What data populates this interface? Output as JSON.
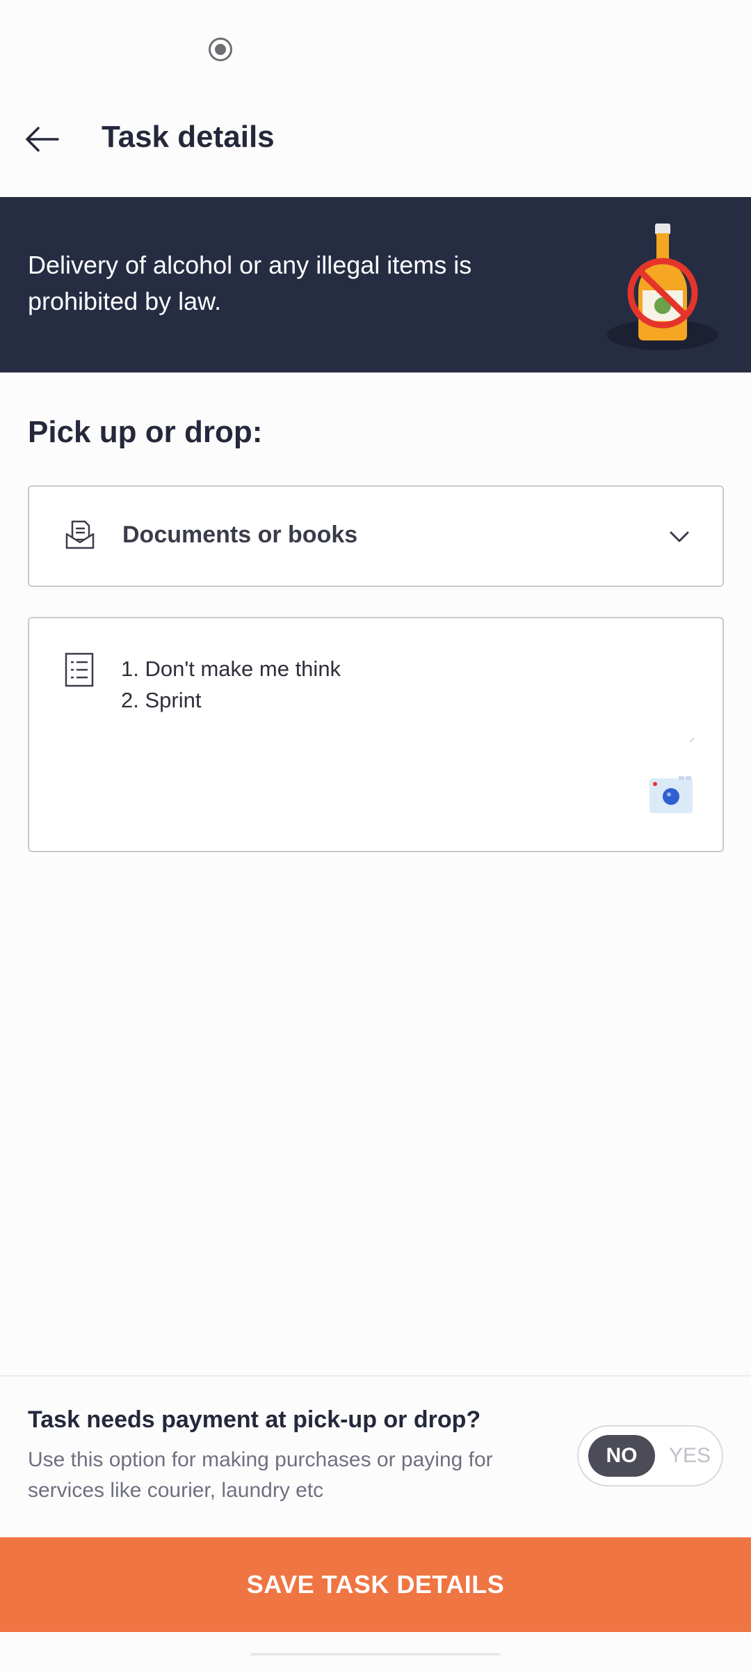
{
  "header": {
    "title": "Task details"
  },
  "banner": {
    "text": "Delivery of alcohol or any illegal items is prohibited by law."
  },
  "section": {
    "title": "Pick up or drop:"
  },
  "category": {
    "selected": "Documents or books"
  },
  "notes": {
    "line1": "1. Don't make me think",
    "line2": "2. Sprint"
  },
  "payment": {
    "title": "Task needs payment at pick-up or drop?",
    "description": "Use this option for making purchases or paying for services like courier, laundry etc",
    "toggle_no": "NO",
    "toggle_yes": "YES",
    "selected": "NO"
  },
  "footer": {
    "save_label": "SAVE TASK DETAILS"
  },
  "colors": {
    "accent": "#ef7543",
    "banner_bg": "#262d43",
    "text": "#24283a"
  },
  "icons": [
    "record-icon",
    "back-arrow-icon",
    "no-alcohol-icon",
    "document-icon",
    "chevron-down-icon",
    "list-icon",
    "camera-icon"
  ]
}
